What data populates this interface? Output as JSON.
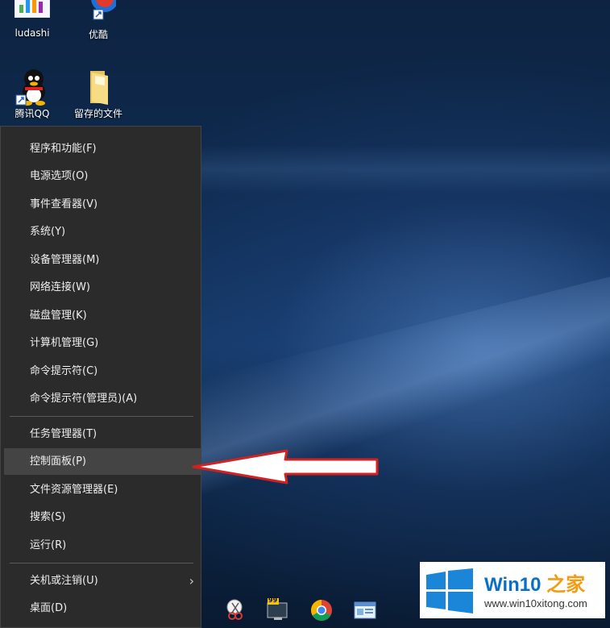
{
  "desktop_icons": [
    {
      "label": "ludashi",
      "icon": "ludashi-icon"
    },
    {
      "label": "优酷",
      "icon": "youku-icon"
    },
    {
      "label": "腾讯QQ",
      "icon": "qq-icon"
    },
    {
      "label": "留存的文件",
      "icon": "folder-icon"
    }
  ],
  "menu": {
    "items": [
      {
        "label": "程序和功能(F)"
      },
      {
        "label": "电源选项(O)"
      },
      {
        "label": "事件查看器(V)"
      },
      {
        "label": "系统(Y)"
      },
      {
        "label": "设备管理器(M)"
      },
      {
        "label": "网络连接(W)"
      },
      {
        "label": "磁盘管理(K)"
      },
      {
        "label": "计算机管理(G)"
      },
      {
        "label": "命令提示符(C)"
      },
      {
        "label": "命令提示符(管理员)(A)"
      },
      {
        "label": "任务管理器(T)"
      },
      {
        "label": "控制面板(P)"
      },
      {
        "label": "文件资源管理器(E)"
      },
      {
        "label": "搜索(S)"
      },
      {
        "label": "运行(R)"
      },
      {
        "label": "关机或注销(U)"
      },
      {
        "label": "桌面(D)"
      }
    ]
  },
  "watermark": {
    "brand_a": "Win10",
    "brand_b": "之家",
    "url": "www.win10xitong.com"
  },
  "taskbar": {
    "badge": "99"
  },
  "colors": {
    "menu_bg": "#2b2b2b",
    "menu_highlight": "#444444",
    "arrow_outline": "#d42020",
    "win_blue": "#0b6fc6"
  }
}
